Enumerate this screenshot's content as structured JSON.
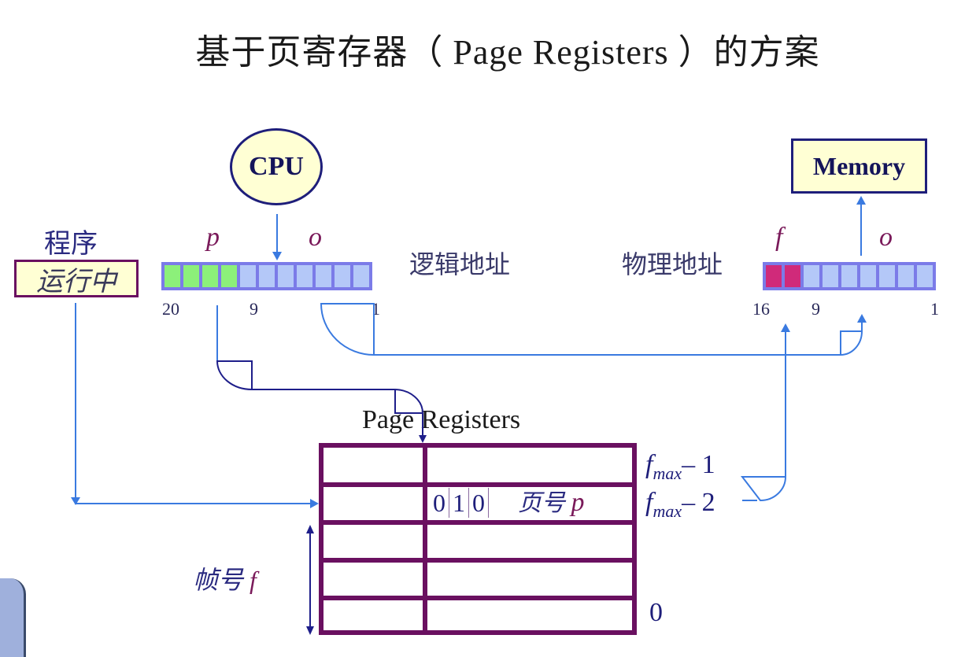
{
  "title": "基于页寄存器（ Page Registers ）的方案",
  "cpu": {
    "label": "CPU"
  },
  "memory": {
    "label": "Memory"
  },
  "program": {
    "label": "程序",
    "status": "运行中"
  },
  "logical_address": {
    "label": "逻辑地址",
    "page_field": "p",
    "offset_field": "o",
    "bit_high": "20",
    "bit_split": "9",
    "bit_low": "1",
    "cells": [
      "green",
      "green",
      "green",
      "green",
      "blue",
      "blue",
      "blue",
      "blue",
      "blue",
      "blue",
      "blue"
    ]
  },
  "physical_address": {
    "label": "物理地址",
    "frame_field": "f",
    "offset_field": "o",
    "bit_high": "16",
    "bit_split": "9",
    "bit_low": "1",
    "cells": [
      "magenta",
      "magenta",
      "blue",
      "blue",
      "blue",
      "blue",
      "blue",
      "blue",
      "blue"
    ]
  },
  "page_registers": {
    "label": "Page Registers",
    "entry_bits": [
      "0",
      "1",
      "0"
    ],
    "entry_page_label": "页号",
    "entry_page_var": "p",
    "row_labels": {
      "top_base": "f",
      "top_sub": "max",
      "top_suffix": "– 1",
      "second_base": "f",
      "second_sub": "max",
      "second_suffix": "– 2",
      "bottom": "0"
    },
    "frame_axis_label": "帧号",
    "frame_axis_var": "f"
  },
  "colors": {
    "arrow_light": "#3a7ae0",
    "arrow_dark": "#1e1e8a",
    "table_border": "#6a1060",
    "highlight_fill": "#ffffd4"
  }
}
